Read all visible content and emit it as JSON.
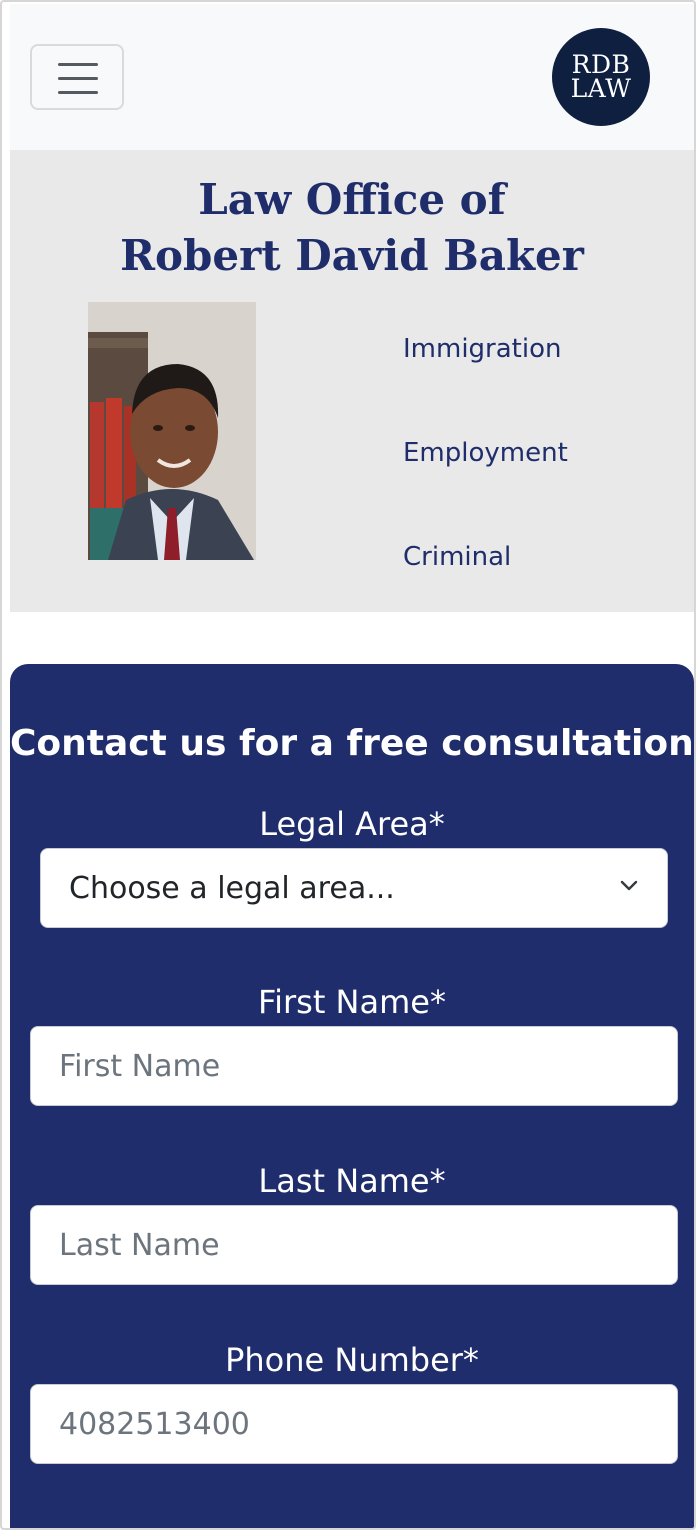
{
  "navbar": {
    "logo_line1": "RDB",
    "logo_line2": "LAW"
  },
  "hero": {
    "title_line1": "Law Office of",
    "title_line2": "Robert David Baker",
    "practice_areas": [
      "Immigration",
      "Employment",
      "Criminal"
    ]
  },
  "contact": {
    "heading": "Contact us for a free consultation!",
    "legal_area_label": "Legal Area*",
    "legal_area_selected": "Choose a legal area...",
    "first_name_label": "First Name*",
    "first_name_placeholder": "First Name",
    "last_name_label": "Last Name*",
    "last_name_placeholder": "Last Name",
    "phone_label": "Phone Number*",
    "phone_placeholder": "4082513400"
  },
  "colors": {
    "brand_navy": "#1f2d6b",
    "form_background": "#202d6c",
    "logo_background": "#0f1f3f",
    "hero_background": "#e9e9e9"
  },
  "icons": [
    "menu-icon",
    "chevron-down-icon"
  ]
}
